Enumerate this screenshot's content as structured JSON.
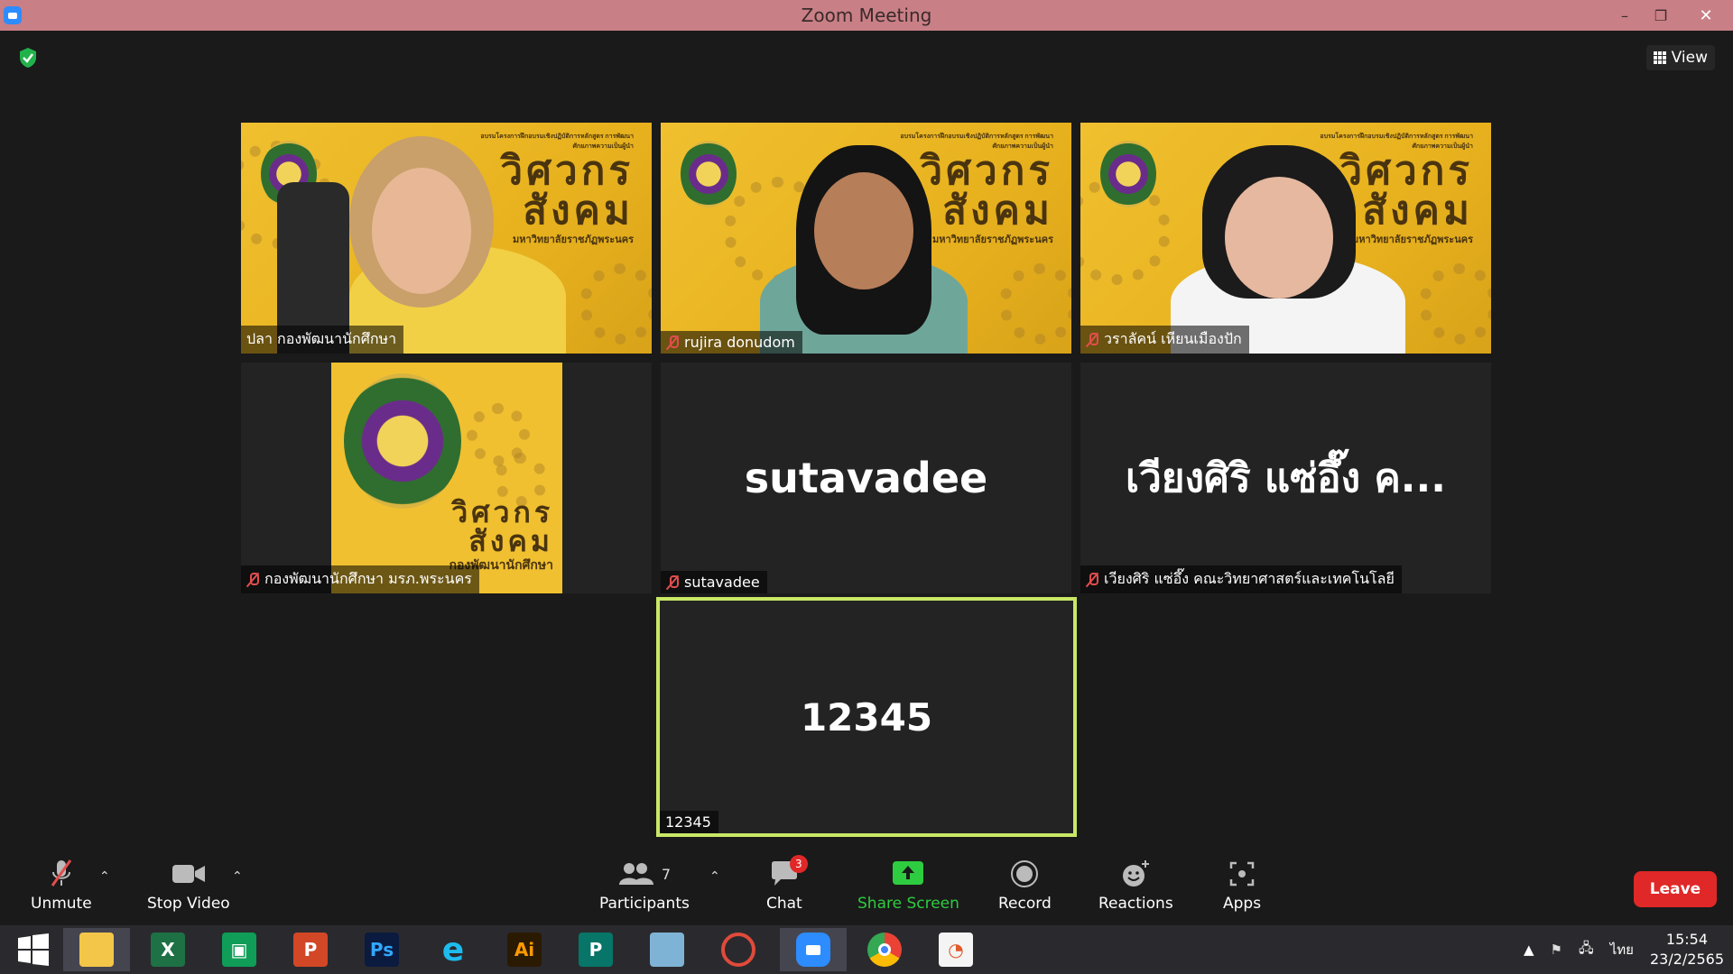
{
  "window": {
    "title": "Zoom Meeting",
    "minimize": "–",
    "restore": "❐",
    "close": "✕"
  },
  "header": {
    "view_label": "View"
  },
  "participants_grid": [
    {
      "display_name": "ปลา กองพัฒนานักศึกษา",
      "muted": false
    },
    {
      "display_name": "rujira donudom",
      "muted": true
    },
    {
      "display_name": "วราลัคน์ เหียนเมืองปัก",
      "muted": true
    },
    {
      "display_name": "กองพัฒนานักศึกษา มรภ.พระนคร",
      "muted": true
    },
    {
      "display_name": "sutavadee",
      "muted": true,
      "placeholder_text": "sutavadee"
    },
    {
      "display_name": "เวียงศิริ แซ่อึ๊ง คณะวิทยาศาสตร์และเทคโนโลยี",
      "muted": true,
      "placeholder_text": "เวียงศิริ แซ่อึ๊ง ค..."
    },
    {
      "display_name": "12345",
      "muted": false,
      "placeholder_text": "12345",
      "active_speaker": true
    }
  ],
  "brand": {
    "big_line1": "วิศวกร",
    "big_line2": "สังคม",
    "university": "มหาวิทยาลัยราชภัฏพระนคร",
    "program_note": "อบรมโครงการฝึกอบรมเชิงปฏิบัติการหลักสูตร การพัฒนาศักยภาพความเป็นผู้นำ",
    "logo_caption": "กองพัฒนานักศึกษา"
  },
  "toolbar": {
    "unmute": "Unmute",
    "stop_video": "Stop Video",
    "participants": "Participants",
    "participants_count": "7",
    "chat": "Chat",
    "chat_badge": "3",
    "share_screen": "Share Screen",
    "record": "Record",
    "reactions": "Reactions",
    "apps": "Apps",
    "leave": "Leave"
  },
  "taskbar": {
    "apps": [
      "start",
      "file-explorer",
      "excel",
      "store",
      "powerpoint",
      "photoshop",
      "internet-explorer",
      "illustrator",
      "publisher",
      "notepad",
      "photoscape",
      "zoom",
      "chrome",
      "presentation"
    ],
    "language": "ไทย",
    "time": "15:54",
    "date": "23/2/2565"
  },
  "colors": {
    "titlebar": "#c97f86",
    "active_speaker_border": "#c9e866",
    "leave": "#e02828",
    "share_green": "#2ecc40"
  }
}
